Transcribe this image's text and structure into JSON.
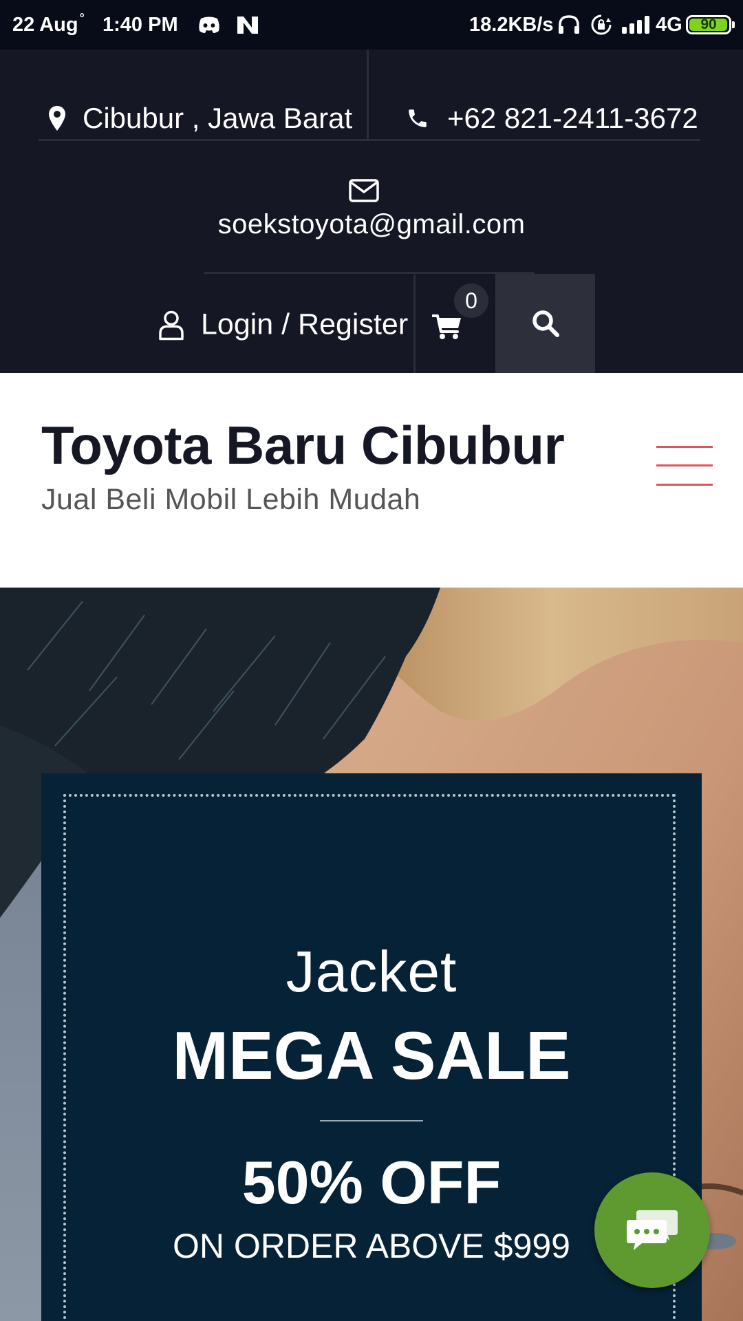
{
  "status_bar": {
    "date": "22 Aug",
    "time": "1:40 PM",
    "speed": "18.2KB/s",
    "network": "4G",
    "battery": "90",
    "icons": [
      "discord-icon",
      "n-icon",
      "headphones-icon",
      "rotation-lock-icon",
      "signal-icon",
      "battery-icon"
    ]
  },
  "topbar": {
    "location": "Cibubur , Jawa Barat",
    "phone": "+62 821-2411-3672",
    "email": "soekstoyota@gmail.com",
    "login": "Login / Register",
    "cart_count": "0",
    "icons": [
      "map-pin-icon",
      "phone-icon",
      "envelope-icon",
      "user-icon",
      "cart-icon",
      "search-icon"
    ]
  },
  "brand": {
    "title": "Toyota Baru Cibubur",
    "tagline": "Jual Beli Mobil Lebih Mudah",
    "menu_icon": "hamburger-icon"
  },
  "hero": {
    "line1": "Jacket",
    "line2": "MEGA SALE",
    "line3": "50% OFF",
    "line4": "ON ORDER ABOVE $999"
  },
  "chat_icon": "chat-icon",
  "colors": {
    "topbar": "#151724",
    "status_bar": "#070c18",
    "promo_box": "#062236",
    "accent_menu": "#e0525e",
    "chat_button": "#5e9a2f",
    "battery": "#7ed321"
  }
}
